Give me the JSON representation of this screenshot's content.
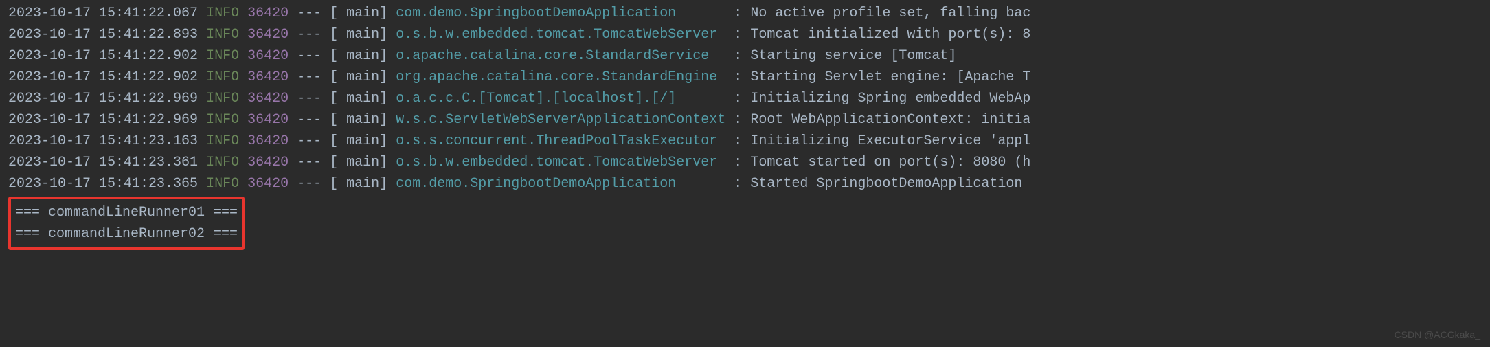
{
  "logs": [
    {
      "timestamp": "2023-10-17 15:41:22.067",
      "level": "INFO",
      "pid": "36420",
      "dashes": "---",
      "thread_open": "[",
      "thread_name": "main]",
      "logger": "com.demo.SpringbootDemoApplication",
      "logger_pad": "       ",
      "colon": ":",
      "message": "No active profile set, falling bac"
    },
    {
      "timestamp": "2023-10-17 15:41:22.893",
      "level": "INFO",
      "pid": "36420",
      "dashes": "---",
      "thread_open": "[",
      "thread_name": "main]",
      "logger": "o.s.b.w.embedded.tomcat.TomcatWebServer",
      "logger_pad": "  ",
      "colon": ":",
      "message": "Tomcat initialized with port(s): 8"
    },
    {
      "timestamp": "2023-10-17 15:41:22.902",
      "level": "INFO",
      "pid": "36420",
      "dashes": "---",
      "thread_open": "[",
      "thread_name": "main]",
      "logger": "o.apache.catalina.core.StandardService",
      "logger_pad": "   ",
      "colon": ":",
      "message": "Starting service [Tomcat]"
    },
    {
      "timestamp": "2023-10-17 15:41:22.902",
      "level": "INFO",
      "pid": "36420",
      "dashes": "---",
      "thread_open": "[",
      "thread_name": "main]",
      "logger": "org.apache.catalina.core.StandardEngine",
      "logger_pad": "  ",
      "colon": ":",
      "message": "Starting Servlet engine: [Apache T"
    },
    {
      "timestamp": "2023-10-17 15:41:22.969",
      "level": "INFO",
      "pid": "36420",
      "dashes": "---",
      "thread_open": "[",
      "thread_name": "main]",
      "logger": "o.a.c.c.C.[Tomcat].[localhost].[/]",
      "logger_pad": "       ",
      "colon": ":",
      "message": "Initializing Spring embedded WebAp"
    },
    {
      "timestamp": "2023-10-17 15:41:22.969",
      "level": "INFO",
      "pid": "36420",
      "dashes": "---",
      "thread_open": "[",
      "thread_name": "main]",
      "logger": "w.s.c.ServletWebServerApplicationContext",
      "logger_pad": " ",
      "colon": ":",
      "message": "Root WebApplicationContext: initia"
    },
    {
      "timestamp": "2023-10-17 15:41:23.163",
      "level": "INFO",
      "pid": "36420",
      "dashes": "---",
      "thread_open": "[",
      "thread_name": "main]",
      "logger": "o.s.s.concurrent.ThreadPoolTaskExecutor",
      "logger_pad": "  ",
      "colon": ":",
      "message": "Initializing ExecutorService 'appl"
    },
    {
      "timestamp": "2023-10-17 15:41:23.361",
      "level": "INFO",
      "pid": "36420",
      "dashes": "---",
      "thread_open": "[",
      "thread_name": "main]",
      "logger": "o.s.b.w.embedded.tomcat.TomcatWebServer",
      "logger_pad": "  ",
      "colon": ":",
      "message": "Tomcat started on port(s): 8080 (h"
    },
    {
      "timestamp": "2023-10-17 15:41:23.365",
      "level": "INFO",
      "pid": "36420",
      "dashes": "---",
      "thread_open": "[",
      "thread_name": "main]",
      "logger": "com.demo.SpringbootDemoApplication",
      "logger_pad": "       ",
      "colon": ":",
      "message": "Started SpringbootDemoApplication"
    }
  ],
  "runners": [
    "=== commandLineRunner01 ===",
    "=== commandLineRunner02 ==="
  ],
  "watermark": "CSDN @ACGkaka_"
}
